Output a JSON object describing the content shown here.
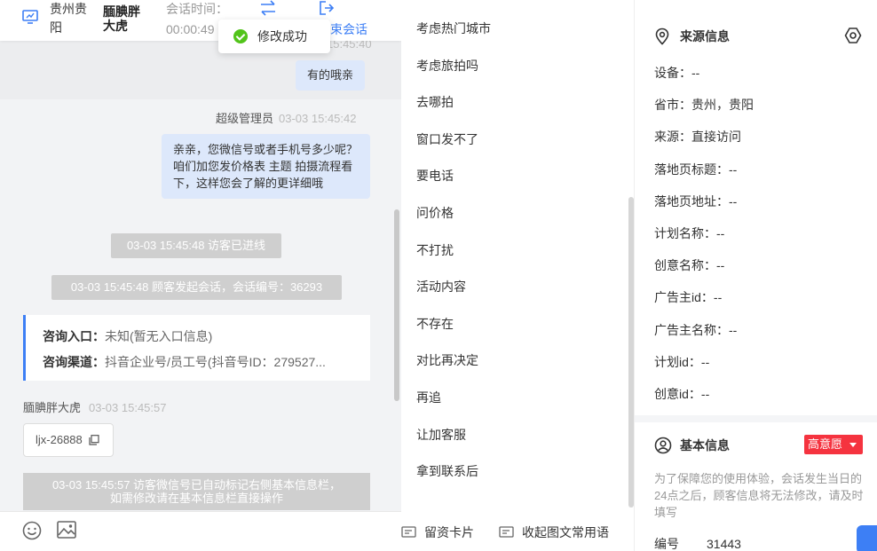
{
  "header": {
    "location": "贵州贵阳",
    "visitor_name": "腼腆胖大虎",
    "session_time_label": "会话时间：",
    "session_time": "00:00:49",
    "end_session_label": "束会话"
  },
  "toast": {
    "text": "修改成功"
  },
  "chat": {
    "partial_timestamp": "15:45:40",
    "customer_message": "有的哦亲",
    "agent_name": "超级管理员",
    "agent_time": "03-03 15:45:42",
    "agent_message": "亲亲，您微信号或者手机号多少呢？咱们加您发价格表 主题 拍摄流程看下，这样您会了解的更详细哦",
    "system_visitor_entered": "03-03 15:45:48 访客已进线",
    "system_session_started": "03-03 15:45:48 顾客发起会话，会话编号：36293",
    "card": {
      "entry_label": "咨询入口：",
      "entry_value": "未知(暂无入口信息)",
      "channel_label": "咨询渠道：",
      "channel_value": "抖音企业号/员工号(抖音号ID：279527..."
    },
    "visitor_name": "腼腆胖大虎",
    "visitor_time": "03-03 15:45:57",
    "wechat_id": "ljx-26888",
    "system_auto_mark_1": "03-03 15:45:57 访客微信号已自动标记右侧基本信息栏，",
    "system_auto_mark_2": "如需修改请在基本信息栏直接操作"
  },
  "phrases": {
    "items": [
      "考虑热门城市",
      "考虑旅拍吗",
      "去哪拍",
      "窗口发不了",
      "要电话",
      "问价格",
      "不打扰",
      "活动内容",
      "不存在",
      "对比再决定",
      "再追",
      "让加客服",
      "拿到联系后"
    ],
    "leave_card_label": "留资卡片",
    "collapse_label": "收起图文常用语"
  },
  "info": {
    "source_title": "来源信息",
    "source_rows": [
      {
        "label": "设备：",
        "value": "--"
      },
      {
        "label": "省市：",
        "value": "贵州，贵阳"
      },
      {
        "label": "来源：",
        "value": "直接访问"
      },
      {
        "label": "落地页标题：",
        "value": "--"
      },
      {
        "label": "落地页地址：",
        "value": "--"
      },
      {
        "label": "计划名称：",
        "value": "--"
      },
      {
        "label": "创意名称：",
        "value": "--"
      },
      {
        "label": "广告主id：",
        "value": "--"
      },
      {
        "label": "广告主名称：",
        "value": "--"
      },
      {
        "label": "计划id：",
        "value": "--"
      },
      {
        "label": "创意id：",
        "value": "--"
      }
    ],
    "basic_title": "基本信息",
    "intent_badge": "高意愿",
    "note": "为了保障您的使用体验，会话发生当日的24点之后，顾客信息将无法修改，请及时填写",
    "number_label": "编号",
    "number_value": "31443"
  },
  "colors": {
    "accent": "#3d7ff5",
    "success": "#52c41a",
    "badge_red": "#f5333f"
  }
}
